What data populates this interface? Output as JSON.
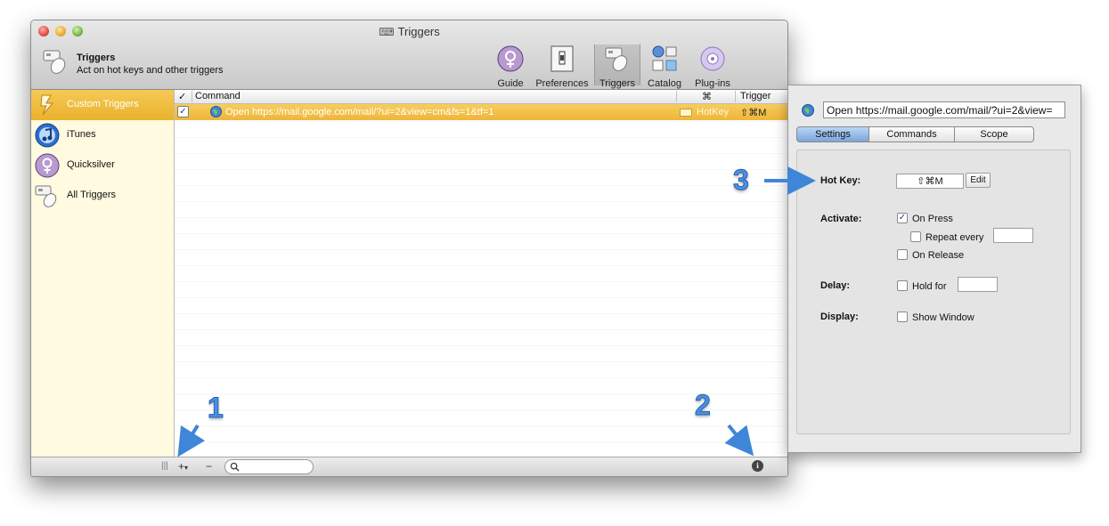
{
  "window": {
    "title": "Triggers"
  },
  "header": {
    "title": "Triggers",
    "subtitle": "Act on hot keys and other triggers"
  },
  "toolbar": {
    "items": [
      {
        "label": "Guide"
      },
      {
        "label": "Preferences"
      },
      {
        "label": "Triggers"
      },
      {
        "label": "Catalog"
      },
      {
        "label": "Plug-ins"
      }
    ]
  },
  "sidebar": {
    "items": [
      {
        "label": "Custom Triggers"
      },
      {
        "label": "iTunes"
      },
      {
        "label": "Quicksilver"
      },
      {
        "label": "All Triggers"
      }
    ]
  },
  "table": {
    "headers": {
      "check": "✓",
      "command": "Command",
      "cmd_symbol": "⌘",
      "trigger": "Trigger"
    },
    "rows": [
      {
        "checked": "✓",
        "command": "Open https://mail.google.com/mail/?ui=2&view=cm&fs=1&tf=1",
        "type": "HotKey",
        "trigger": "⇧⌘M"
      }
    ]
  },
  "bottombar": {
    "resize": "|||",
    "add": "+",
    "add_arrow": "▾",
    "remove": "−",
    "info": "i"
  },
  "drawer": {
    "command_field": "Open https://mail.google.com/mail/?ui=2&view=",
    "tabs": [
      {
        "label": "Settings"
      },
      {
        "label": "Commands"
      },
      {
        "label": "Scope"
      }
    ],
    "hotkey_label": "Hot Key:",
    "hotkey_value": "⇧⌘M",
    "edit_label": "Edit",
    "activate_label": "Activate:",
    "on_press": "On Press",
    "repeat_every": "Repeat every",
    "on_release": "On Release",
    "delay_label": "Delay:",
    "hold_for": "Hold for",
    "display_label": "Display:",
    "show_window": "Show Window",
    "check_mark": "✓"
  },
  "callouts": {
    "one": "1",
    "two": "2",
    "three": "3"
  }
}
